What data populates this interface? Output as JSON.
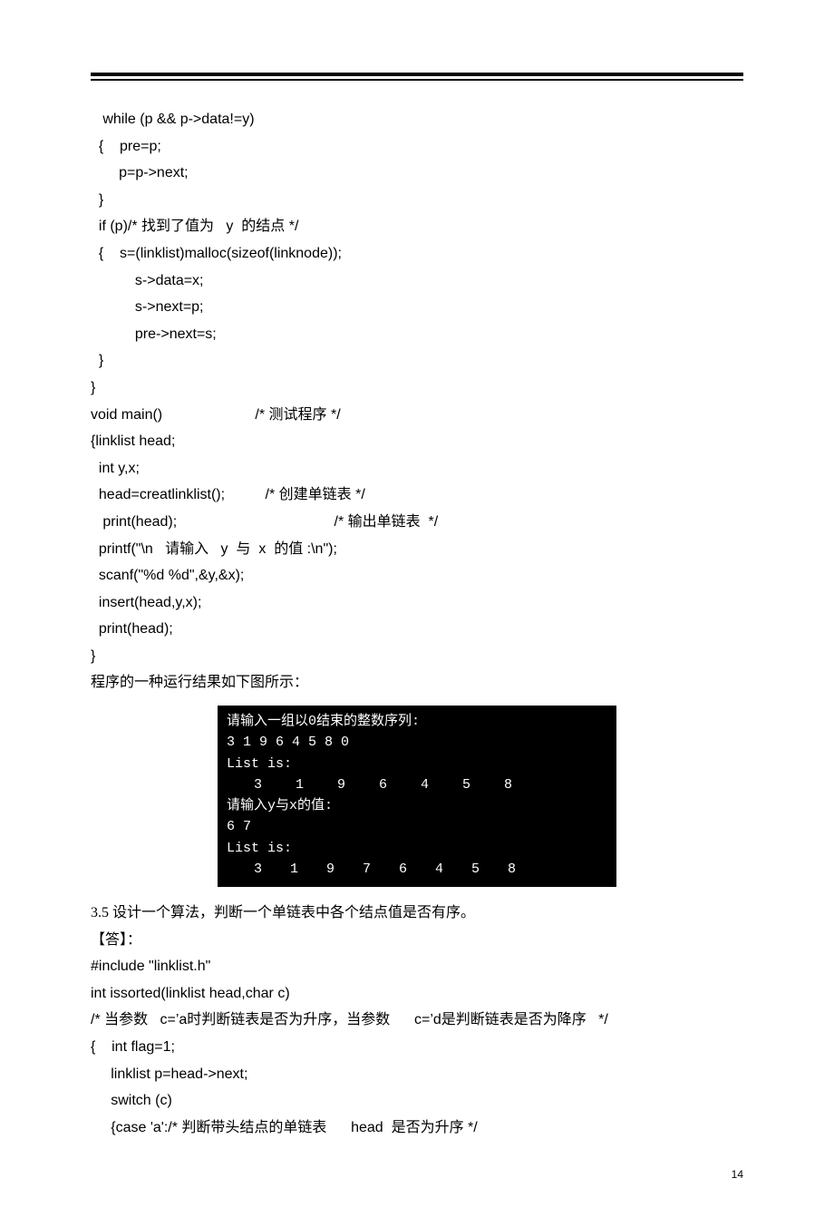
{
  "code1": {
    "l1": "   while (p && p->data!=y)",
    "l2": "  {    pre=p;",
    "l3": "       p=p->next;",
    "l4": "  }",
    "l5a": "  if (p)/* ",
    "l5b": "找到了值为",
    "l5c": "   y  ",
    "l5d": "的结点",
    "l5e": " */",
    "l6": "  {    s=(linklist)malloc(sizeof(linknode));",
    "l7": "           s->data=x;",
    "l8": "           s->next=p;",
    "l9": "           pre->next=s;",
    "l10": "  }",
    "l11": "}",
    "l12a": "void main()                       /* ",
    "l12b": "测试程序",
    "l12c": " */",
    "l13": "{linklist head;",
    "l14": "  int y,x;",
    "l15a": "  head=creatlinklist();          /* ",
    "l15b": "创建单链表",
    "l15c": " */",
    "l16a": "   print(head);                                       /* ",
    "l16b": "输出单链表",
    "l16c": "  */",
    "l17a": "  printf(\"\\n   ",
    "l17b": "请输入",
    "l17c": "   y  ",
    "l17d": "与",
    "l17e": "  x  ",
    "l17f": "的值",
    "l17g": " :\\n\");",
    "l18": "  scanf(\"%d %d\",&y,&x);",
    "l19": "  insert(head,y,x);",
    "l20": "  print(head);",
    "l21": "}"
  },
  "desc1": "程序的一种运行结果如下图所示：",
  "console": {
    "r1": "请输入一组以0结束的整数序列:",
    "r2": "3 1 9 6 4 5 8 0",
    "r3": "List is:",
    "r4": "3 1 9 6 4 5 8",
    "r5": "",
    "r6": "请输入y与x的值:",
    "r7": "6 7",
    "r8": "List is:",
    "r9": "3 1 9 7 6 4 5 8"
  },
  "sec35": "3.5  设计一个算法，判断一个单链表中各个结点值是否有序。",
  "ans": "【答】：",
  "code2": {
    "l1": "#include \"linklist.h\"",
    "l2": "int issorted(linklist head,char c)",
    "l3a": "/* ",
    "l3b": "当参数",
    "l3c": "   c=’a时",
    "l3d": "判断链表是否为升序，当参数",
    "l3e": "      c=’d是",
    "l3f": "判断链表是否为降序",
    "l3g": "   */",
    "l4": "{    int flag=1;",
    "l5": "     linklist p=head->next;",
    "l6": "     switch (c)",
    "l7a": "     {case 'a':/* ",
    "l7b": "判断带头结点的单链表",
    "l7c": "      head  ",
    "l7d": "是否为升序",
    "l7e": " */"
  },
  "page": "14"
}
